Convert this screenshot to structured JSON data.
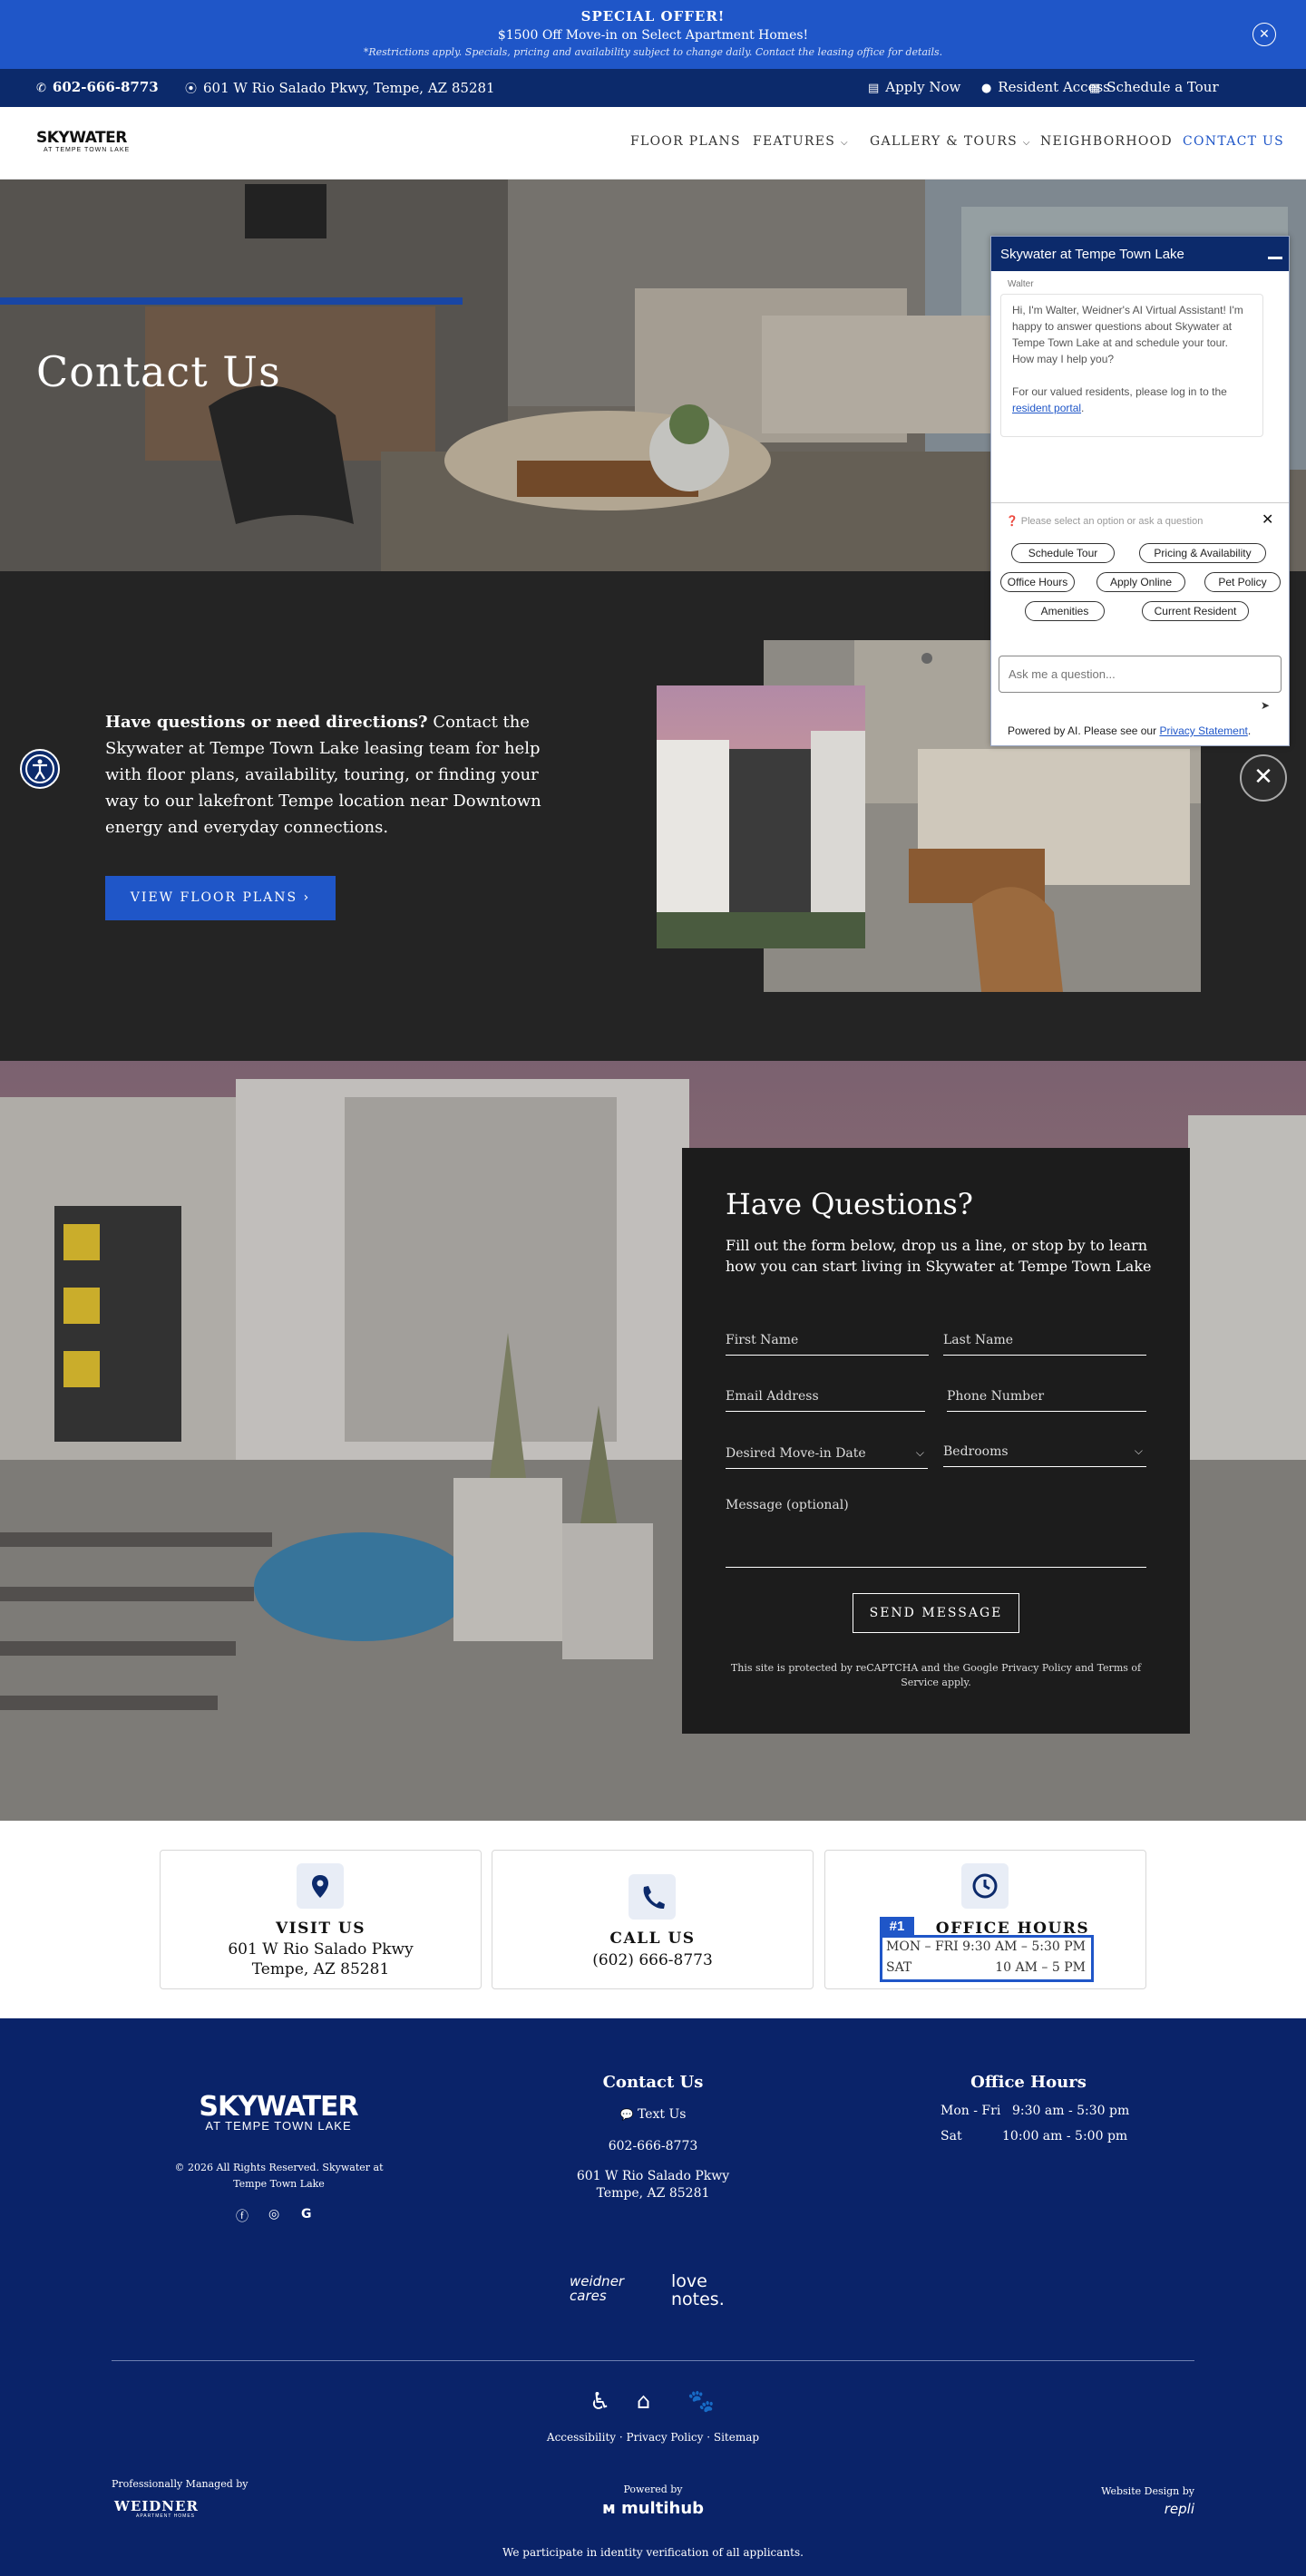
{
  "promo": {
    "title": "SPECIAL OFFER!",
    "offer": "$1500 Off Move-in on Select Apartment Homes!",
    "note": "*Restrictions apply. Specials, pricing and availability subject to change daily. Contact the leasing office for details.",
    "close_icon": "close-icon"
  },
  "utility": {
    "phone": "602-666-8773",
    "address": "601 W Rio Salado Pkwy, Tempe, AZ 85281",
    "apply": "Apply Now",
    "resident": "Resident Access",
    "tour": "Schedule a Tour"
  },
  "brand": {
    "name": "SKYWATER",
    "sub": "AT TEMPE TOWN LAKE"
  },
  "nav": {
    "items": [
      "FLOOR PLANS",
      "FEATURES",
      "GALLERY & TOURS",
      "NEIGHBORHOOD",
      "CONTACT US"
    ]
  },
  "hero": {
    "title": "Contact Us"
  },
  "intro": {
    "lead": "Have questions or need directions?",
    "body": " Contact the Skywater at Tempe Town Lake leasing team for help with floor plans, availability, touring, or finding your way to our lakefront Tempe location near Downtown energy and everyday connections.",
    "cta": "VIEW FLOOR PLANS"
  },
  "form": {
    "title": "Have Questions?",
    "intro": "Fill out the form below, drop us a line, or stop by to learn how you can start living in Skywater at Tempe Town Lake",
    "first_name": "First Name",
    "last_name": "Last Name",
    "email": "Email Address",
    "phone": "Phone Number",
    "move_in": "Desired Move-in Date",
    "bedrooms": "Bedrooms",
    "message": "Message (optional)",
    "submit": "SEND MESSAGE",
    "recaptcha": "This site is protected by reCAPTCHA and the Google Privacy Policy and Terms of Service apply."
  },
  "cards": {
    "visit": {
      "title": "VISIT US",
      "line1": "601 W Rio Salado Pkwy",
      "line2": "Tempe, AZ 85281"
    },
    "call": {
      "title": "CALL US",
      "line1": "(602) 666-8773"
    },
    "hours": {
      "title": "OFFICE HOURS",
      "badge": "#1",
      "rows": [
        {
          "day": "MON – FRI",
          "time": "9:30 AM – 5:30 PM"
        },
        {
          "day": "SAT",
          "time": "10 AM – 5 PM"
        }
      ]
    }
  },
  "footer": {
    "brand": "SKYWATER",
    "brand_sub": "AT TEMPE TOWN LAKE",
    "copyright": "© 2026 All Rights Reserved. Skywater at Tempe Town Lake",
    "contact_title": "Contact Us",
    "text_us": "Text Us",
    "phone": "602-666-8773",
    "addr1": "601 W Rio Salado Pkwy",
    "addr2": "Tempe, AZ 85281",
    "hours_title": "Office Hours",
    "hours": [
      {
        "day": "Mon - Fri",
        "time": "9:30 am - 5:30 pm"
      },
      {
        "day": "Sat",
        "time": "10:00 am - 5:00 pm"
      }
    ],
    "cares": "weidner cares",
    "love": "love notes.",
    "links": [
      "Accessibility",
      "Privacy Policy",
      "Sitemap"
    ],
    "managed_by": "Professionally Managed by",
    "weidner": "WEIDNER",
    "weidner_sub": "APARTMENT HOMES",
    "powered_by": "Powered by",
    "multihub": "multihub",
    "design_by": "Website Design by",
    "repli": "repli",
    "identity": "We participate in identity verification of all applicants."
  },
  "chat": {
    "title": "Skywater at Tempe Town Lake",
    "sender": "Walter",
    "greeting": "Hi, I'm Walter, Weidner's AI Virtual Assistant! I'm happy to answer questions about Skywater at Tempe Town Lake at and schedule your tour. How may I help you?",
    "residents": "For our valued residents, please log in to the",
    "portal": "resident portal",
    "prompt": "Please select an option or ask a question",
    "chips": [
      "Schedule Tour",
      "Pricing & Availability",
      "Office Hours",
      "Apply Online",
      "Pet Policy",
      "Amenities",
      "Current Resident"
    ],
    "placeholder": "Ask me a question...",
    "powered": "Powered by AI. Please see our",
    "privacy": "Privacy Statement"
  }
}
